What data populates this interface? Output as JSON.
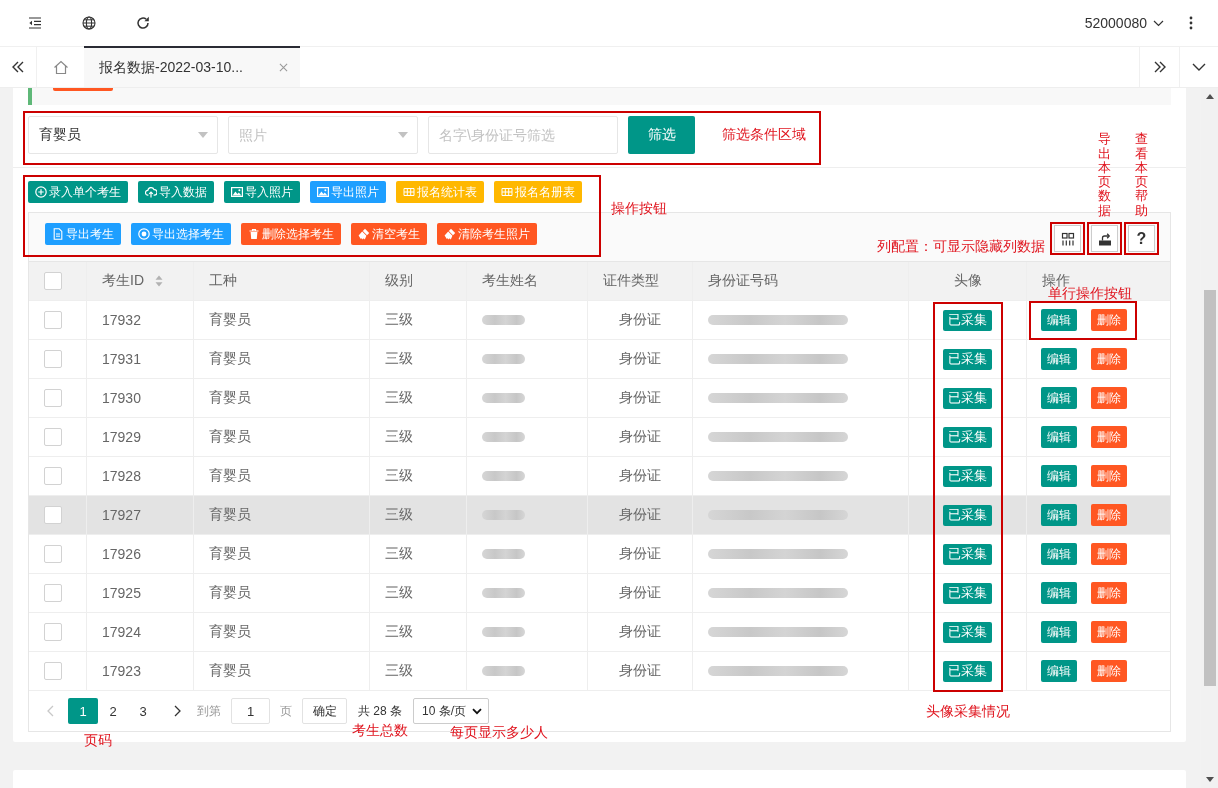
{
  "topbar": {
    "user": "52000080"
  },
  "tabs": [
    {
      "label": "报名数据-2022-03-10...",
      "selected": true
    }
  ],
  "filter_bar": {
    "outlined": true,
    "selects": [
      {
        "value": "育婴员"
      },
      {
        "placeholder": "照片"
      }
    ],
    "search": {
      "placeholder": "名字\\身份证号筛选"
    },
    "button": "筛选",
    "note": "筛选条件区域"
  },
  "actions": {
    "outlined": true,
    "note": "操作按钮",
    "buttons": [
      {
        "label": "录入单个考生",
        "kind": "add",
        "color": "#009688"
      },
      {
        "label": "导入数据",
        "kind": "import",
        "color": "#009688"
      },
      {
        "label": "导入照片",
        "kind": "import-photo",
        "color": "#009688"
      },
      {
        "label": "导出照片",
        "kind": "export-photo",
        "color": "#1e9fff"
      },
      {
        "label": "报名统计表",
        "kind": "stats",
        "color": "#ffb800"
      },
      {
        "label": "报名名册表",
        "kind": "roster",
        "color": "#ffb800"
      }
    ]
  },
  "table": {
    "toolbar_buttons": [
      {
        "label": "导出考生",
        "kind": "export",
        "color": "#1e9fff"
      },
      {
        "label": "导出选择考生",
        "kind": "export-selected",
        "color": "#1e9fff"
      },
      {
        "label": "删除选择考生",
        "kind": "delete-selected",
        "color": "#ff5722"
      },
      {
        "label": "清空考生",
        "kind": "clear",
        "color": "#ff5722"
      },
      {
        "label": "清除考生照片",
        "kind": "clear-photos",
        "color": "#ff5722"
      }
    ],
    "tools": [
      {
        "kind": "columns",
        "outlined": true,
        "note": "列配置：可显示隐藏列数据"
      },
      {
        "kind": "export",
        "outlined": true,
        "note": "导出本页数据"
      },
      {
        "kind": "help",
        "label": "?",
        "outlined": true,
        "note": "查看本页帮助"
      }
    ],
    "columns": [
      {
        "kind": "checkbox",
        "checked": false,
        "sortable": false,
        "redacted": false,
        "outlined": false
      },
      {
        "kind": "text",
        "label": "考生ID",
        "sortable": true,
        "redacted": false,
        "outlined": false
      },
      {
        "kind": "text",
        "label": "工种",
        "sortable": false,
        "redacted": false,
        "outlined": false
      },
      {
        "kind": "text",
        "label": "级别",
        "sortable": false,
        "redacted": false,
        "outlined": false
      },
      {
        "kind": "text",
        "label": "考生姓名",
        "sortable": false,
        "redacted": true,
        "outlined": false
      },
      {
        "kind": "text",
        "label": "证件类型",
        "sortable": false,
        "redacted": false,
        "outlined": false
      },
      {
        "kind": "text",
        "label": "身份证号码",
        "sortable": false,
        "redacted": true,
        "outlined": false
      },
      {
        "kind": "badge",
        "label": "头像",
        "sortable": false,
        "redacted": false,
        "outlined": true,
        "note": "头像采集情况"
      },
      {
        "kind": "actions",
        "label": "操作",
        "sortable": false,
        "redacted": false,
        "outlined": false
      }
    ],
    "rows": [
      {
        "checked": false,
        "hovered": false,
        "id": "17932",
        "job": "育婴员",
        "grade": "三级",
        "id_type": "身份证",
        "photo_status": "已采集",
        "actions": [
          {
            "label": "编辑",
            "color": "#009688"
          },
          {
            "label": "删除",
            "color": "#ff5722"
          }
        ],
        "actions_outlined": true,
        "actions_note": "单行操作按钮"
      },
      {
        "checked": false,
        "hovered": false,
        "id": "17931",
        "job": "育婴员",
        "grade": "三级",
        "id_type": "身份证",
        "photo_status": "已采集",
        "actions": [
          {
            "label": "编辑",
            "color": "#009688"
          },
          {
            "label": "删除",
            "color": "#ff5722"
          }
        ],
        "actions_outlined": false
      },
      {
        "checked": false,
        "hovered": false,
        "id": "17930",
        "job": "育婴员",
        "grade": "三级",
        "id_type": "身份证",
        "photo_status": "已采集",
        "actions": [
          {
            "label": "编辑",
            "color": "#009688"
          },
          {
            "label": "删除",
            "color": "#ff5722"
          }
        ],
        "actions_outlined": false
      },
      {
        "checked": false,
        "hovered": false,
        "id": "17929",
        "job": "育婴员",
        "grade": "三级",
        "id_type": "身份证",
        "photo_status": "已采集",
        "actions": [
          {
            "label": "编辑",
            "color": "#009688"
          },
          {
            "label": "删除",
            "color": "#ff5722"
          }
        ],
        "actions_outlined": false
      },
      {
        "checked": false,
        "hovered": false,
        "id": "17928",
        "job": "育婴员",
        "grade": "三级",
        "id_type": "身份证",
        "photo_status": "已采集",
        "actions": [
          {
            "label": "编辑",
            "color": "#009688"
          },
          {
            "label": "删除",
            "color": "#ff5722"
          }
        ],
        "actions_outlined": false
      },
      {
        "checked": false,
        "hovered": true,
        "id": "17927",
        "job": "育婴员",
        "grade": "三级",
        "id_type": "身份证",
        "photo_status": "已采集",
        "actions": [
          {
            "label": "编辑",
            "color": "#009688"
          },
          {
            "label": "删除",
            "color": "#ff5722"
          }
        ],
        "actions_outlined": false
      },
      {
        "checked": false,
        "hovered": false,
        "id": "17926",
        "job": "育婴员",
        "grade": "三级",
        "id_type": "身份证",
        "photo_status": "已采集",
        "actions": [
          {
            "label": "编辑",
            "color": "#009688"
          },
          {
            "label": "删除",
            "color": "#ff5722"
          }
        ],
        "actions_outlined": false
      },
      {
        "checked": false,
        "hovered": false,
        "id": "17925",
        "job": "育婴员",
        "grade": "三级",
        "id_type": "身份证",
        "photo_status": "已采集",
        "actions": [
          {
            "label": "编辑",
            "color": "#009688"
          },
          {
            "label": "删除",
            "color": "#ff5722"
          }
        ],
        "actions_outlined": false
      },
      {
        "checked": false,
        "hovered": false,
        "id": "17924",
        "job": "育婴员",
        "grade": "三级",
        "id_type": "身份证",
        "photo_status": "已采集",
        "actions": [
          {
            "label": "编辑",
            "color": "#009688"
          },
          {
            "label": "删除",
            "color": "#ff5722"
          }
        ],
        "actions_outlined": false
      },
      {
        "checked": false,
        "hovered": false,
        "id": "17923",
        "job": "育婴员",
        "grade": "三级",
        "id_type": "身份证",
        "photo_status": "已采集",
        "actions": [
          {
            "label": "编辑",
            "color": "#009688"
          },
          {
            "label": "删除",
            "color": "#ff5722"
          }
        ],
        "actions_outlined": false
      }
    ]
  },
  "pagination": {
    "prev": {
      "disabled": true
    },
    "next": {
      "disabled": false
    },
    "pages": [
      {
        "label": "1",
        "selected": true
      },
      {
        "label": "2",
        "selected": false
      },
      {
        "label": "3",
        "selected": false
      }
    ],
    "pages_note": "页码",
    "goto_label": "到第",
    "goto_value": "1",
    "goto_suffix": "页",
    "confirm": "确定",
    "total": "共 28 条",
    "total_note": "考生总数",
    "page_size": "10 条/页",
    "page_size_note": "每页显示多少人"
  }
}
